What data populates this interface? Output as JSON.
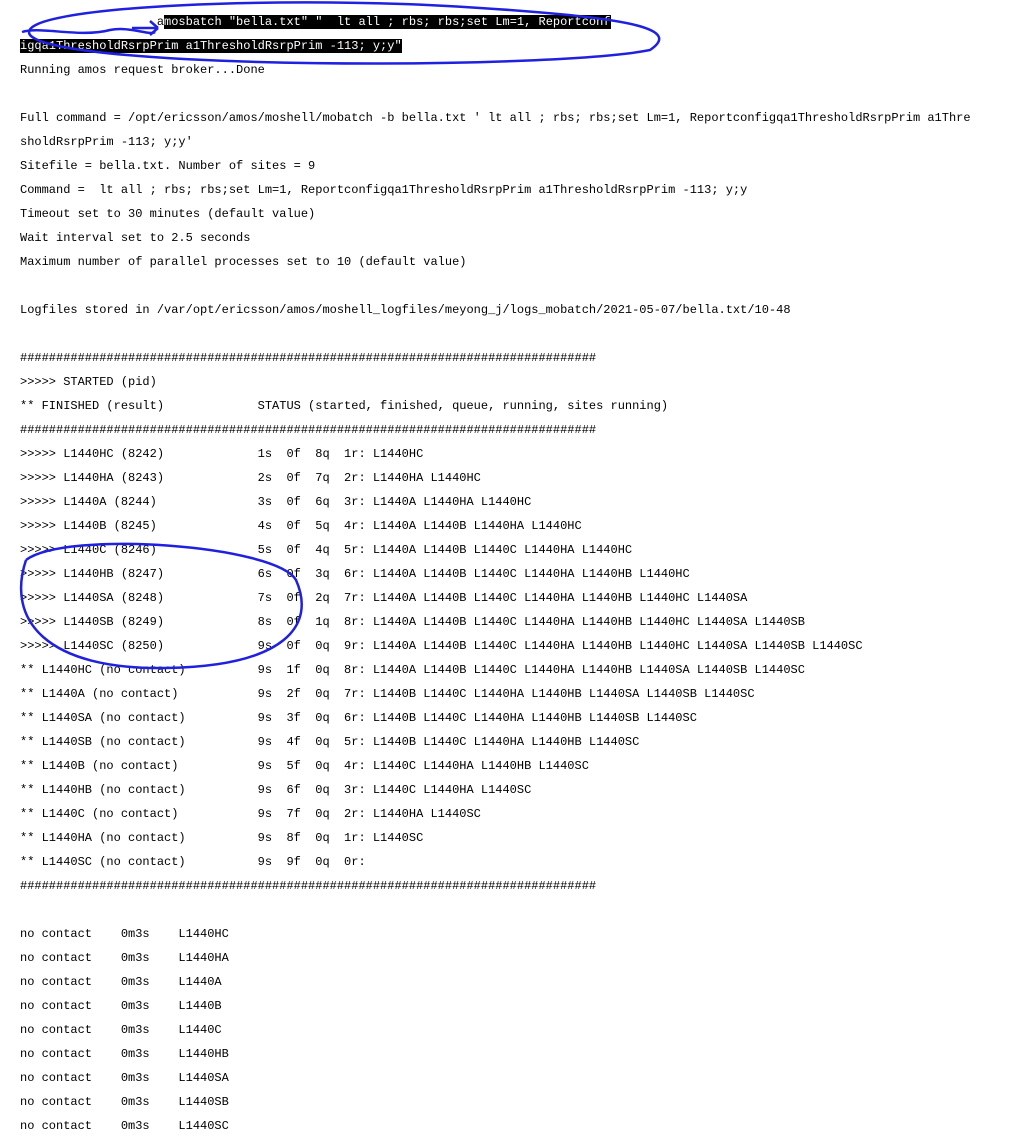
{
  "cmd_hl_prefix": "a",
  "cmd_hl_1": "mosbatch \"bella.txt\" \"  lt all ; rbs; rbs;set Lm=1, Reportconf",
  "cmd_hl_2": "igqa1ThresholdRsrpPrim a1ThresholdRsrpPrim -113; y;y\"",
  "running": "Running amos request broker...Done",
  "full_cmd_1": "Full command = /opt/ericsson/amos/moshell/mobatch -b bella.txt ' lt all ; rbs; rbs;set Lm=1, Reportconfigqa1ThresholdRsrpPrim a1Thre",
  "full_cmd_2": "sholdRsrpPrim -113; y;y'",
  "sitefile": "Sitefile = bella.txt. Number of sites = 9",
  "command_l": "Command =  lt all ; rbs; rbs;set Lm=1, Reportconfigqa1ThresholdRsrpPrim a1ThresholdRsrpPrim -113; y;y",
  "timeout": "Timeout set to 30 minutes (default value)",
  "wait": "Wait interval set to 2.5 seconds",
  "maxp": "Maximum number of parallel processes set to 10 (default value)",
  "logfiles": "Logfiles stored in /var/opt/ericsson/amos/moshell_logfiles/meyong_j/logs_mobatch/2021-05-07/bella.txt/10-48",
  "bar": "################################################################################",
  "started_hdr": ">>>>> STARTED (pid)",
  "finished_hdr": "** FINISHED (result)             STATUS (started, finished, queue, running, sites running)",
  "r": [
    ">>>>> L1440HC (8242)             1s  0f  8q  1r: L1440HC",
    ">>>>> L1440HA (8243)             2s  0f  7q  2r: L1440HA L1440HC",
    ">>>>> L1440A (8244)              3s  0f  6q  3r: L1440A L1440HA L1440HC",
    ">>>>> L1440B (8245)              4s  0f  5q  4r: L1440A L1440B L1440HA L1440HC",
    ">>>>> L1440C (8246)              5s  0f  4q  5r: L1440A L1440B L1440C L1440HA L1440HC",
    ">>>>> L1440HB (8247)             6s  0f  3q  6r: L1440A L1440B L1440C L1440HA L1440HB L1440HC",
    ">>>>> L1440SA (8248)             7s  0f  2q  7r: L1440A L1440B L1440C L1440HA L1440HB L1440HC L1440SA",
    ">>>>> L1440SB (8249)             8s  0f  1q  8r: L1440A L1440B L1440C L1440HA L1440HB L1440HC L1440SA L1440SB",
    ">>>>> L1440SC (8250)             9s  0f  0q  9r: L1440A L1440B L1440C L1440HA L1440HB L1440HC L1440SA L1440SB L1440SC",
    "** L1440HC (no contact)          9s  1f  0q  8r: L1440A L1440B L1440C L1440HA L1440HB L1440SA L1440SB L1440SC",
    "** L1440A (no contact)           9s  2f  0q  7r: L1440B L1440C L1440HA L1440HB L1440SA L1440SB L1440SC",
    "** L1440SA (no contact)          9s  3f  0q  6r: L1440B L1440C L1440HA L1440HB L1440SB L1440SC",
    "** L1440SB (no contact)          9s  4f  0q  5r: L1440B L1440C L1440HA L1440HB L1440SC",
    "** L1440B (no contact)           9s  5f  0q  4r: L1440C L1440HA L1440HB L1440SC",
    "** L1440HB (no contact)          9s  6f  0q  3r: L1440C L1440HA L1440SC",
    "** L1440C (no contact)           9s  7f  0q  2r: L1440HA L1440SC",
    "** L1440HA (no contact)          9s  8f  0q  1r: L1440SC",
    "** L1440SC (no contact)          9s  9f  0q  0r:"
  ],
  "nc": [
    "no contact    0m3s    L1440HC",
    "no contact    0m3s    L1440HA",
    "no contact    0m3s    L1440A",
    "no contact    0m3s    L1440B",
    "no contact    0m3s    L1440C",
    "no contact    0m3s    L1440HB",
    "no contact    0m3s    L1440SA",
    "no contact    0m3s    L1440SB",
    "no contact    0m3s    L1440SC"
  ]
}
